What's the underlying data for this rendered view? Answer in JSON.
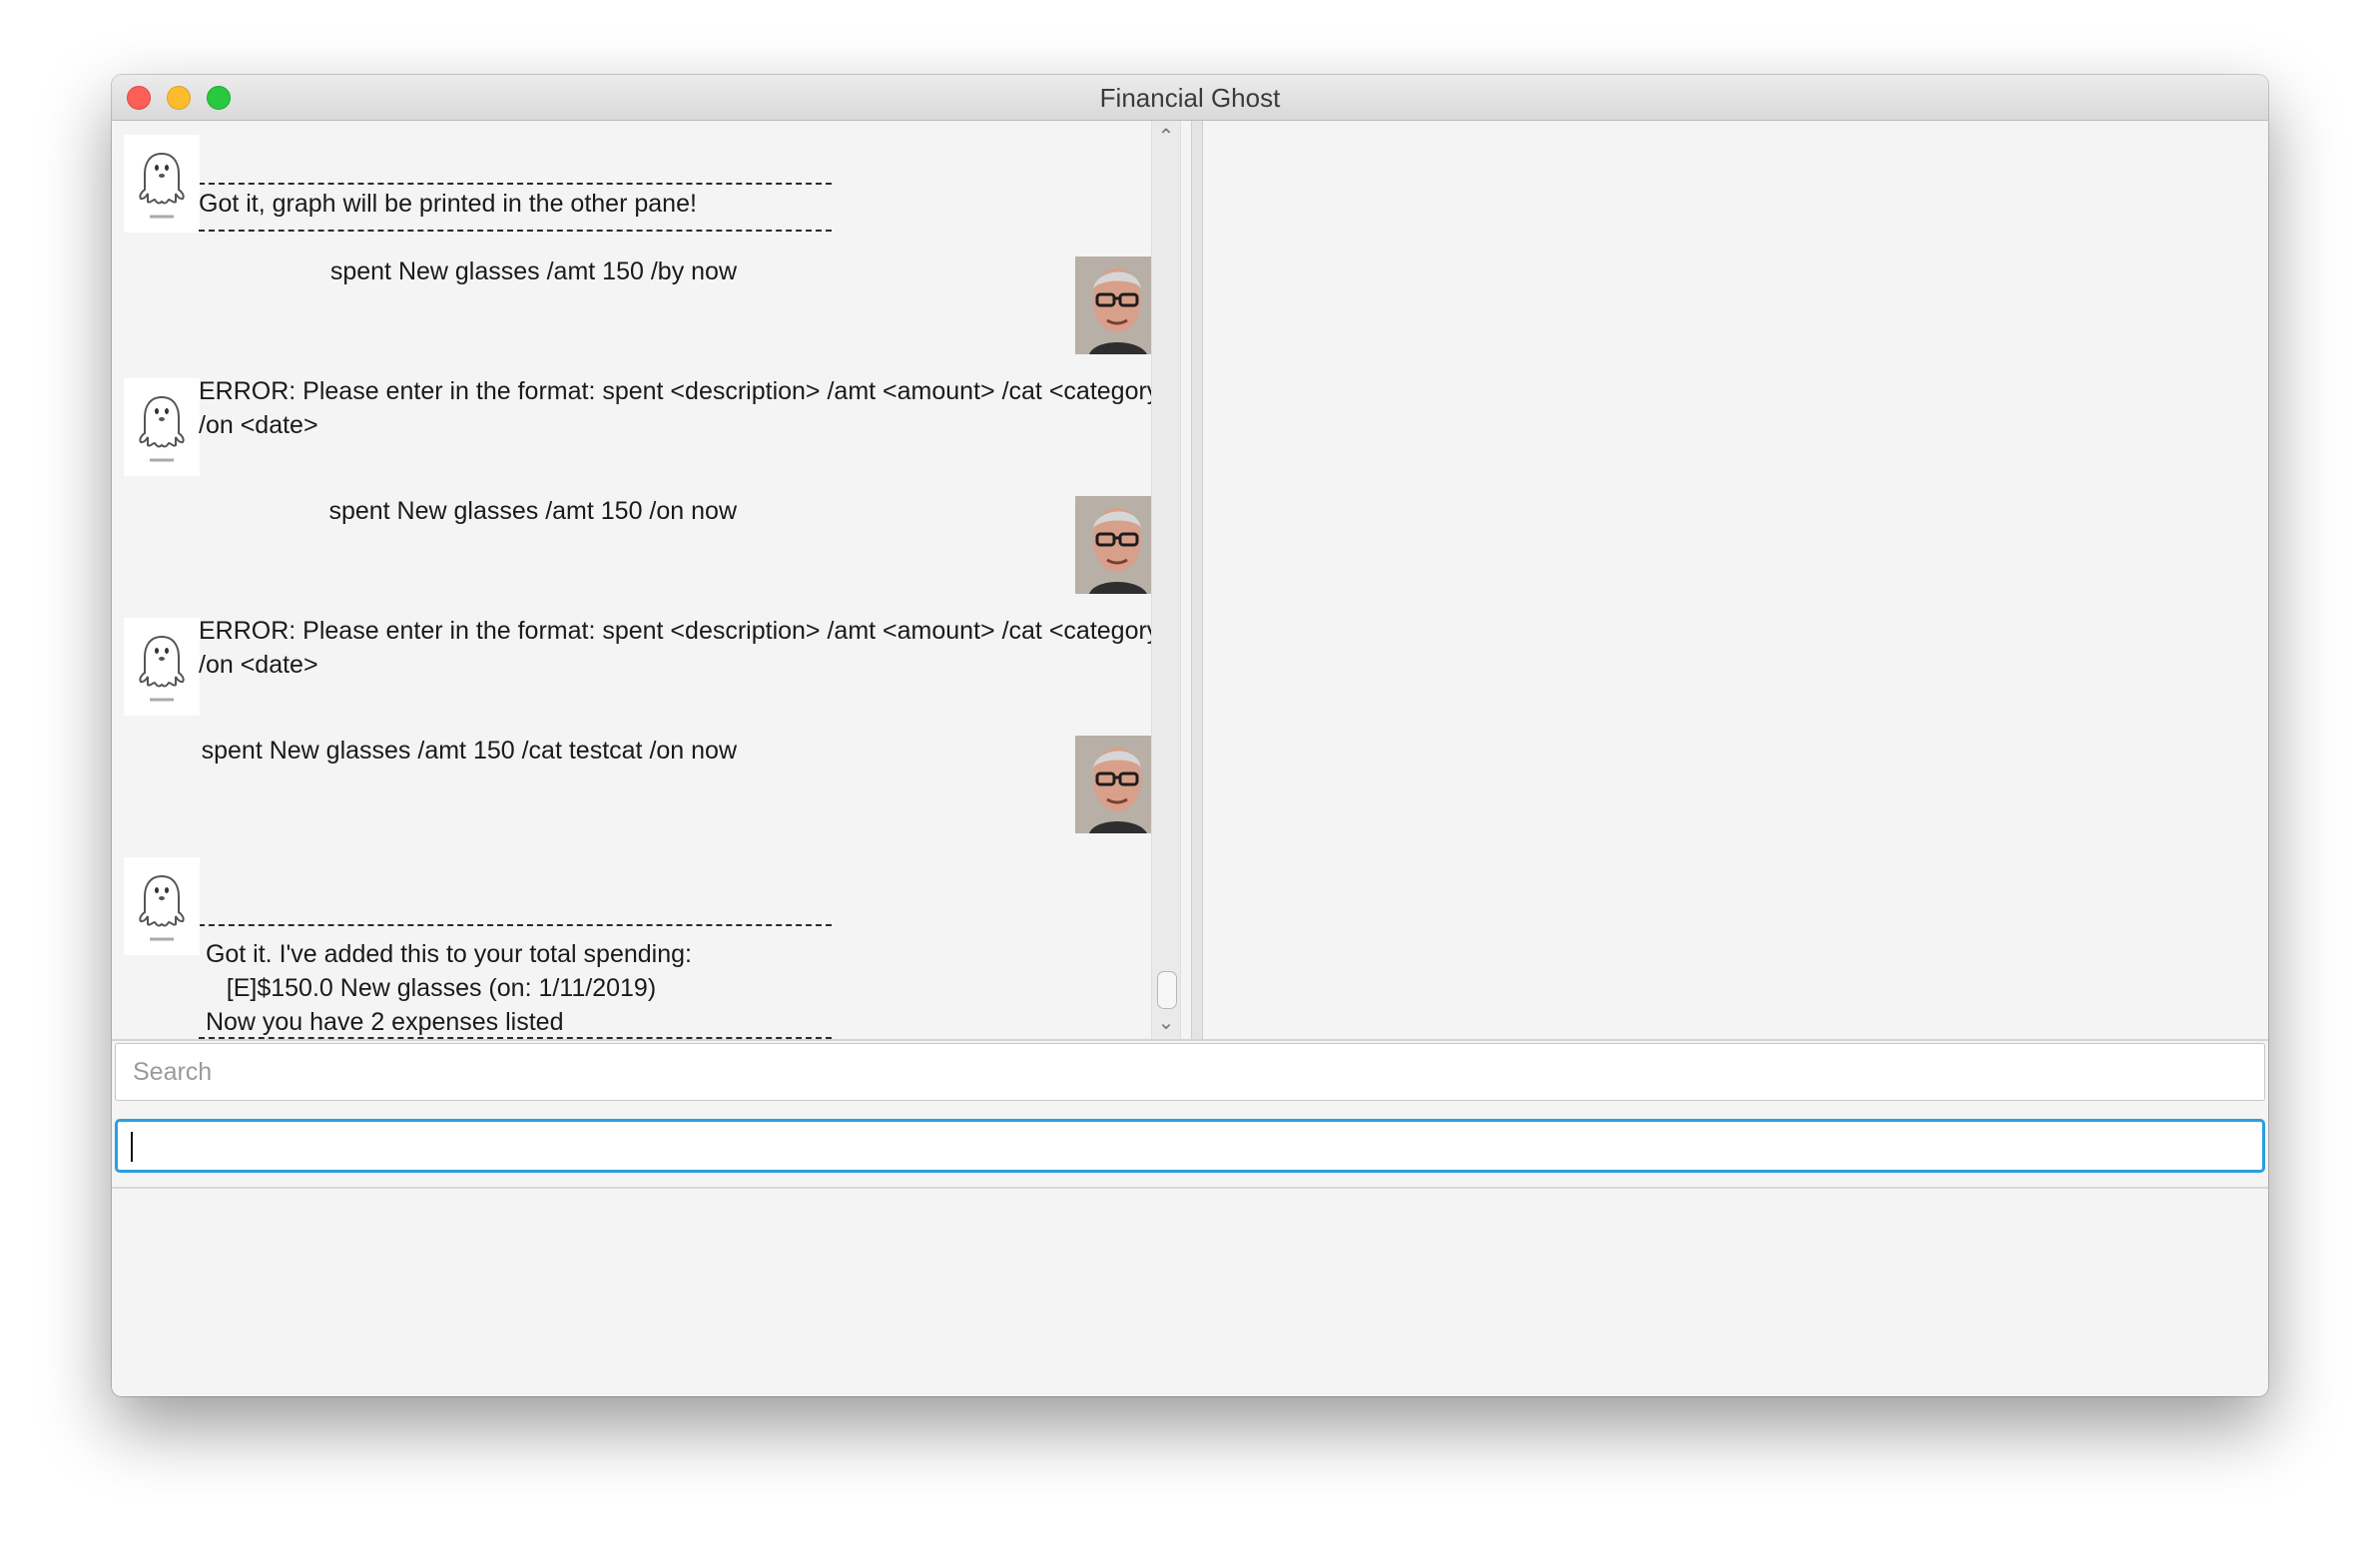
{
  "window": {
    "title": "Financial Ghost"
  },
  "chat": {
    "messages": [
      {
        "sender": "bot",
        "lines": [
          "Got it, graph will be printed in the other pane!"
        ],
        "dashes": true
      },
      {
        "sender": "user",
        "text": "spent New glasses /amt 150 /by now"
      },
      {
        "sender": "bot",
        "lines": [
          "ERROR: Please enter in the format: spent <description> /amt <amount> /cat <category>",
          "/on <date>"
        ]
      },
      {
        "sender": "user",
        "text": "spent New glasses /amt 150 /on now"
      },
      {
        "sender": "bot",
        "lines": [
          "ERROR: Please enter in the format: spent <description> /amt <amount> /cat <category>",
          "/on <date>"
        ]
      },
      {
        "sender": "user",
        "text": "spent New glasses /amt 150 /cat testcat /on now"
      },
      {
        "sender": "bot",
        "lines": [
          " Got it. I've added this to your total spending:",
          "    [E]$150.0 New glasses (on: 1/11/2019)",
          " Now you have 2 expenses listed"
        ],
        "dashes": true
      }
    ]
  },
  "search": {
    "placeholder": "Search"
  },
  "command": {
    "value": ""
  },
  "icons": {
    "bot": "ghost-icon",
    "user": "user-photo",
    "scroll_up": "chevron-up-icon",
    "scroll_down": "chevron-down-icon"
  }
}
